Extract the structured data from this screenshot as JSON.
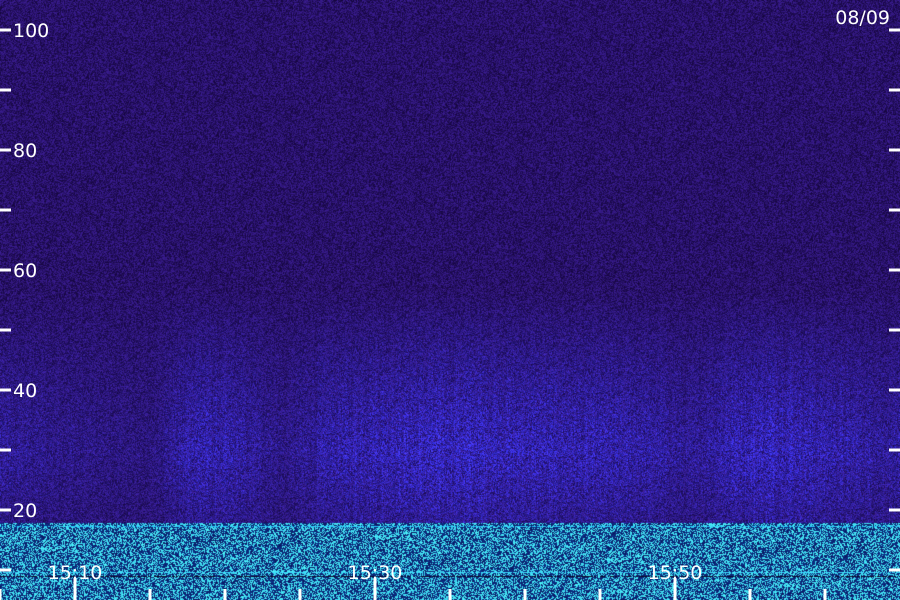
{
  "chart_data": {
    "type": "heatmap",
    "title": "",
    "xlabel": "",
    "ylabel": "",
    "date": "08/09",
    "ylim": [
      0,
      100
    ],
    "y_ticks_major": [
      20,
      40,
      60,
      80,
      100
    ],
    "y_ticks_major_labels": [
      "20",
      "40",
      "60",
      "80",
      "100"
    ],
    "y_ticks_minor": [
      10,
      30,
      50,
      70,
      90
    ],
    "x_range_minutes": [
      "15:05",
      "16:05"
    ],
    "x_ticks_major": [
      "15:10",
      "15:30",
      "15:50"
    ],
    "x_ticks_minor": [
      "15:05",
      "15:15",
      "15:20",
      "15:25",
      "15:35",
      "15:40",
      "15:45",
      "15:55",
      "16:00"
    ],
    "background_color": "#23115a",
    "energy_color": "#2a3cff",
    "low_band_color": "#24e0ff",
    "energy_band_range": [
      15,
      55
    ],
    "energy_intensity": [
      {
        "time": "15:05",
        "level": 0.45
      },
      {
        "time": "15:08",
        "level": 0.35
      },
      {
        "time": "15:12",
        "level": 0.25
      },
      {
        "time": "15:15",
        "level": 0.2
      },
      {
        "time": "15:18",
        "level": 0.7
      },
      {
        "time": "15:21",
        "level": 0.55
      },
      {
        "time": "15:24",
        "level": 0.3
      },
      {
        "time": "15:27",
        "level": 0.6
      },
      {
        "time": "15:30",
        "level": 0.75
      },
      {
        "time": "15:33",
        "level": 0.8
      },
      {
        "time": "15:36",
        "level": 0.85
      },
      {
        "time": "15:39",
        "level": 0.75
      },
      {
        "time": "15:42",
        "level": 0.7
      },
      {
        "time": "15:45",
        "level": 0.65
      },
      {
        "time": "15:48",
        "level": 0.6
      },
      {
        "time": "15:51",
        "level": 0.4
      },
      {
        "time": "15:54",
        "level": 0.75
      },
      {
        "time": "15:57",
        "level": 0.85
      },
      {
        "time": "16:00",
        "level": 0.65
      },
      {
        "time": "16:04",
        "level": 0.5
      }
    ]
  }
}
